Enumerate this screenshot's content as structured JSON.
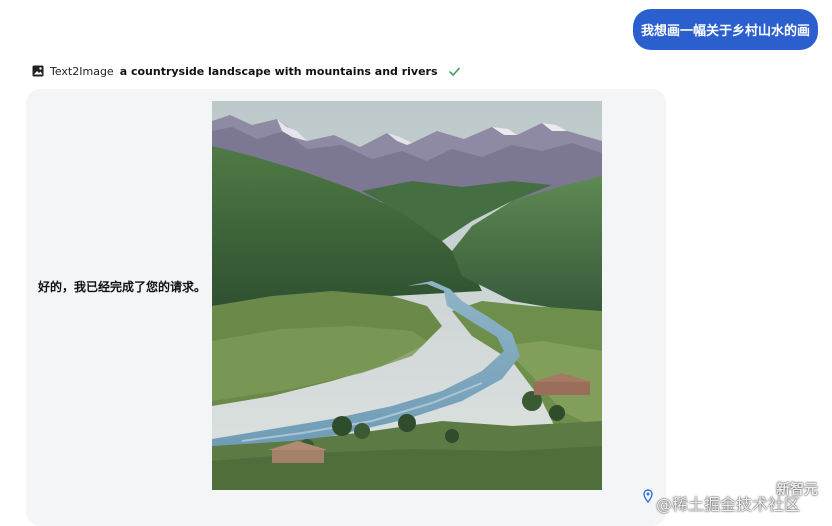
{
  "user_message": "我想画一幅关于乡村山水的画",
  "tool_call": {
    "icon": "image-icon",
    "tool_name": "Text2Image",
    "prompt": "a countryside landscape with mountains and rivers",
    "status_icon": "check-icon"
  },
  "assistant": {
    "reply": "好的，我已经完成了您的请求。",
    "image_icon": "generated-landscape-image"
  },
  "watermark": {
    "brand": "新智元",
    "site": "@稀土掘金技术社区"
  },
  "colors": {
    "user_bubble": "#2b5fce",
    "card_bg": "#f4f5f7",
    "check": "#3aa05a",
    "location_icon": "#3b6fd6"
  }
}
